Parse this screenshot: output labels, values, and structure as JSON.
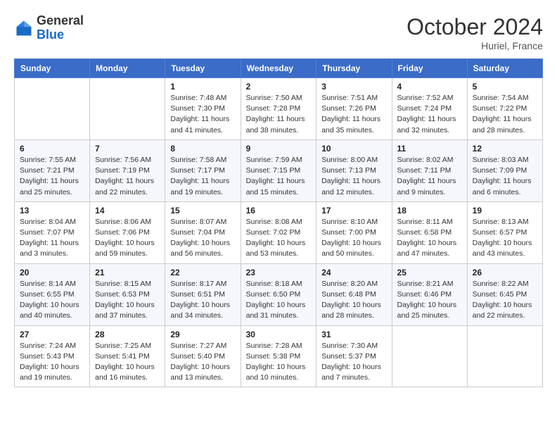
{
  "header": {
    "logo_general": "General",
    "logo_blue": "Blue",
    "month_title": "October 2024",
    "location": "Huriel, France"
  },
  "days_of_week": [
    "Sunday",
    "Monday",
    "Tuesday",
    "Wednesday",
    "Thursday",
    "Friday",
    "Saturday"
  ],
  "weeks": [
    [
      {
        "day": "",
        "info": ""
      },
      {
        "day": "",
        "info": ""
      },
      {
        "day": "1",
        "sunrise": "7:48 AM",
        "sunset": "7:30 PM",
        "daylight": "11 hours and 41 minutes."
      },
      {
        "day": "2",
        "sunrise": "7:50 AM",
        "sunset": "7:28 PM",
        "daylight": "11 hours and 38 minutes."
      },
      {
        "day": "3",
        "sunrise": "7:51 AM",
        "sunset": "7:26 PM",
        "daylight": "11 hours and 35 minutes."
      },
      {
        "day": "4",
        "sunrise": "7:52 AM",
        "sunset": "7:24 PM",
        "daylight": "11 hours and 32 minutes."
      },
      {
        "day": "5",
        "sunrise": "7:54 AM",
        "sunset": "7:22 PM",
        "daylight": "11 hours and 28 minutes."
      }
    ],
    [
      {
        "day": "6",
        "sunrise": "7:55 AM",
        "sunset": "7:21 PM",
        "daylight": "11 hours and 25 minutes."
      },
      {
        "day": "7",
        "sunrise": "7:56 AM",
        "sunset": "7:19 PM",
        "daylight": "11 hours and 22 minutes."
      },
      {
        "day": "8",
        "sunrise": "7:58 AM",
        "sunset": "7:17 PM",
        "daylight": "11 hours and 19 minutes."
      },
      {
        "day": "9",
        "sunrise": "7:59 AM",
        "sunset": "7:15 PM",
        "daylight": "11 hours and 15 minutes."
      },
      {
        "day": "10",
        "sunrise": "8:00 AM",
        "sunset": "7:13 PM",
        "daylight": "11 hours and 12 minutes."
      },
      {
        "day": "11",
        "sunrise": "8:02 AM",
        "sunset": "7:11 PM",
        "daylight": "11 hours and 9 minutes."
      },
      {
        "day": "12",
        "sunrise": "8:03 AM",
        "sunset": "7:09 PM",
        "daylight": "11 hours and 6 minutes."
      }
    ],
    [
      {
        "day": "13",
        "sunrise": "8:04 AM",
        "sunset": "7:07 PM",
        "daylight": "11 hours and 3 minutes."
      },
      {
        "day": "14",
        "sunrise": "8:06 AM",
        "sunset": "7:06 PM",
        "daylight": "10 hours and 59 minutes."
      },
      {
        "day": "15",
        "sunrise": "8:07 AM",
        "sunset": "7:04 PM",
        "daylight": "10 hours and 56 minutes."
      },
      {
        "day": "16",
        "sunrise": "8:08 AM",
        "sunset": "7:02 PM",
        "daylight": "10 hours and 53 minutes."
      },
      {
        "day": "17",
        "sunrise": "8:10 AM",
        "sunset": "7:00 PM",
        "daylight": "10 hours and 50 minutes."
      },
      {
        "day": "18",
        "sunrise": "8:11 AM",
        "sunset": "6:58 PM",
        "daylight": "10 hours and 47 minutes."
      },
      {
        "day": "19",
        "sunrise": "8:13 AM",
        "sunset": "6:57 PM",
        "daylight": "10 hours and 43 minutes."
      }
    ],
    [
      {
        "day": "20",
        "sunrise": "8:14 AM",
        "sunset": "6:55 PM",
        "daylight": "10 hours and 40 minutes."
      },
      {
        "day": "21",
        "sunrise": "8:15 AM",
        "sunset": "6:53 PM",
        "daylight": "10 hours and 37 minutes."
      },
      {
        "day": "22",
        "sunrise": "8:17 AM",
        "sunset": "6:51 PM",
        "daylight": "10 hours and 34 minutes."
      },
      {
        "day": "23",
        "sunrise": "8:18 AM",
        "sunset": "6:50 PM",
        "daylight": "10 hours and 31 minutes."
      },
      {
        "day": "24",
        "sunrise": "8:20 AM",
        "sunset": "6:48 PM",
        "daylight": "10 hours and 28 minutes."
      },
      {
        "day": "25",
        "sunrise": "8:21 AM",
        "sunset": "6:46 PM",
        "daylight": "10 hours and 25 minutes."
      },
      {
        "day": "26",
        "sunrise": "8:22 AM",
        "sunset": "6:45 PM",
        "daylight": "10 hours and 22 minutes."
      }
    ],
    [
      {
        "day": "27",
        "sunrise": "7:24 AM",
        "sunset": "5:43 PM",
        "daylight": "10 hours and 19 minutes."
      },
      {
        "day": "28",
        "sunrise": "7:25 AM",
        "sunset": "5:41 PM",
        "daylight": "10 hours and 16 minutes."
      },
      {
        "day": "29",
        "sunrise": "7:27 AM",
        "sunset": "5:40 PM",
        "daylight": "10 hours and 13 minutes."
      },
      {
        "day": "30",
        "sunrise": "7:28 AM",
        "sunset": "5:38 PM",
        "daylight": "10 hours and 10 minutes."
      },
      {
        "day": "31",
        "sunrise": "7:30 AM",
        "sunset": "5:37 PM",
        "daylight": "10 hours and 7 minutes."
      },
      {
        "day": "",
        "info": ""
      },
      {
        "day": "",
        "info": ""
      }
    ]
  ],
  "labels": {
    "sunrise": "Sunrise:",
    "sunset": "Sunset:",
    "daylight": "Daylight:"
  }
}
